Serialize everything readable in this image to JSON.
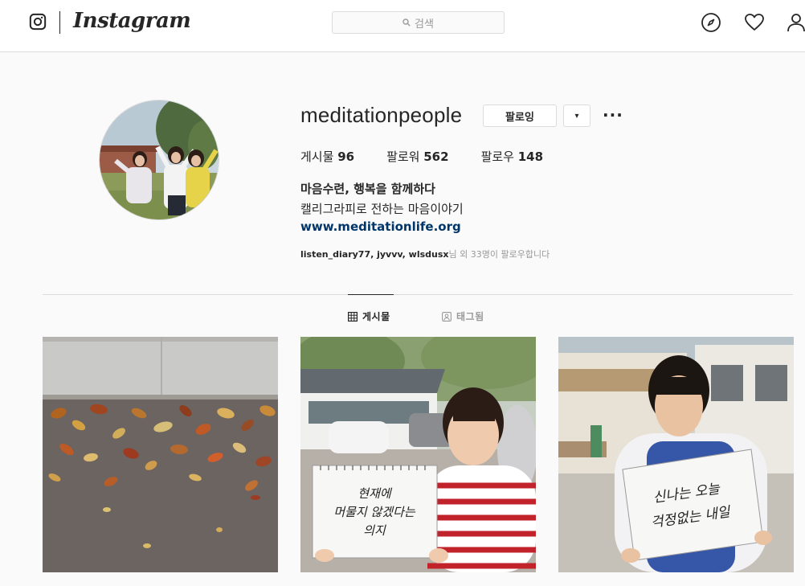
{
  "topbar": {
    "brand": "Instagram",
    "search_placeholder": "검색",
    "icons": [
      "instagram-glyph-icon",
      "search-icon",
      "explore-compass-icon",
      "activity-heart-icon",
      "profile-person-icon"
    ]
  },
  "profile": {
    "username": "meditationpeople",
    "follow_button": "팔로잉",
    "dropdown_button": "▾",
    "more_button": "···",
    "stats": [
      {
        "label": "게시물",
        "value": "96"
      },
      {
        "label": "팔로워",
        "value": "562"
      },
      {
        "label": "팔로우",
        "value": "148"
      }
    ],
    "full_name": "마음수련, 행복을 함께하다",
    "bio": "캘리그라피로 전하는 마음이야기",
    "website": "www.meditationlife.org",
    "followed_by_names": "listen_diary77, jyvvv, wlsdusx",
    "followed_by_suffix": "님 외 33명이 팔로우합니다"
  },
  "tabs": [
    {
      "label": "게시물",
      "active": true
    },
    {
      "label": "태그됨",
      "active": false
    }
  ],
  "posts": [
    {
      "description": "autumn leaves on pavement"
    },
    {
      "description": "man holding sketchbook",
      "sign_text": "현재에 머물지 않겠다는 의지"
    },
    {
      "description": "woman holding sketchbook",
      "sign_text": "신나는 오늘 걱정없는 내일"
    }
  ],
  "colors": {
    "link": "#003569",
    "border": "#dbdbdb",
    "muted": "#999999"
  }
}
